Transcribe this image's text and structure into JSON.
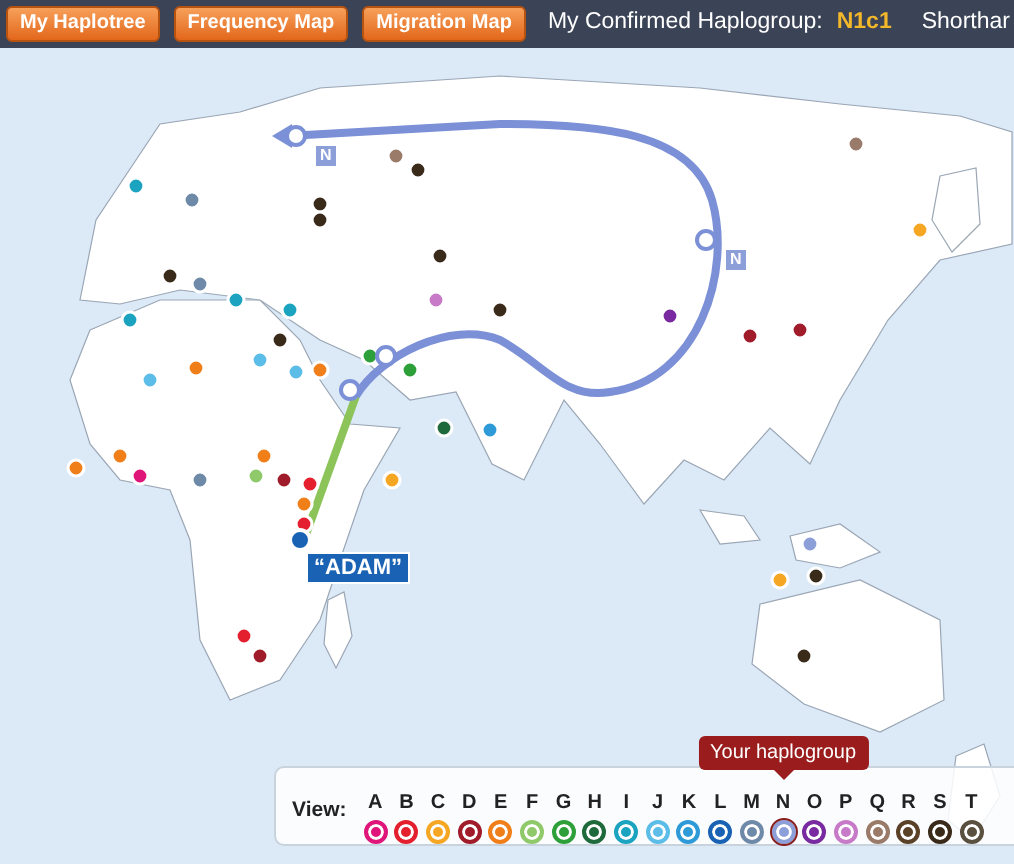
{
  "toolbar": {
    "buttons": [
      "My Haplotree",
      "Frequency Map",
      "Migration Map"
    ],
    "haplogroup_label": "My Confirmed Haplogroup:",
    "haplogroup_value": "N1c1",
    "cut_text": "Shorthar"
  },
  "map": {
    "route_labels": [
      "N",
      "N"
    ],
    "origin_label": "“ADAM”"
  },
  "legend": {
    "label": "View:",
    "tooltip": "Your haplogroup",
    "items": [
      {
        "letter": "A",
        "color": "#e0157a",
        "selected": false
      },
      {
        "letter": "B",
        "color": "#e4202f",
        "selected": false
      },
      {
        "letter": "C",
        "color": "#f5a623",
        "selected": false
      },
      {
        "letter": "D",
        "color": "#a01c2a",
        "selected": false
      },
      {
        "letter": "E",
        "color": "#f07f1a",
        "selected": false
      },
      {
        "letter": "F",
        "color": "#8fc96a",
        "selected": false
      },
      {
        "letter": "G",
        "color": "#2ea03a",
        "selected": false
      },
      {
        "letter": "H",
        "color": "#1e6a3a",
        "selected": false
      },
      {
        "letter": "I",
        "color": "#1ba3c0",
        "selected": false
      },
      {
        "letter": "J",
        "color": "#5bbde8",
        "selected": false
      },
      {
        "letter": "K",
        "color": "#2e9ad8",
        "selected": false
      },
      {
        "letter": "L",
        "color": "#1a62b3",
        "selected": false
      },
      {
        "letter": "M",
        "color": "#6e8aa8",
        "selected": false
      },
      {
        "letter": "N",
        "color": "#8c9fd8",
        "selected": true
      },
      {
        "letter": "O",
        "color": "#7a2aa0",
        "selected": false
      },
      {
        "letter": "P",
        "color": "#c77ac8",
        "selected": false
      },
      {
        "letter": "Q",
        "color": "#9a7a68",
        "selected": false
      },
      {
        "letter": "R",
        "color": "#5a4228",
        "selected": false
      },
      {
        "letter": "S",
        "color": "#3a2a1a",
        "selected": false
      },
      {
        "letter": "T",
        "color": "#5a5040",
        "selected": false
      }
    ]
  }
}
